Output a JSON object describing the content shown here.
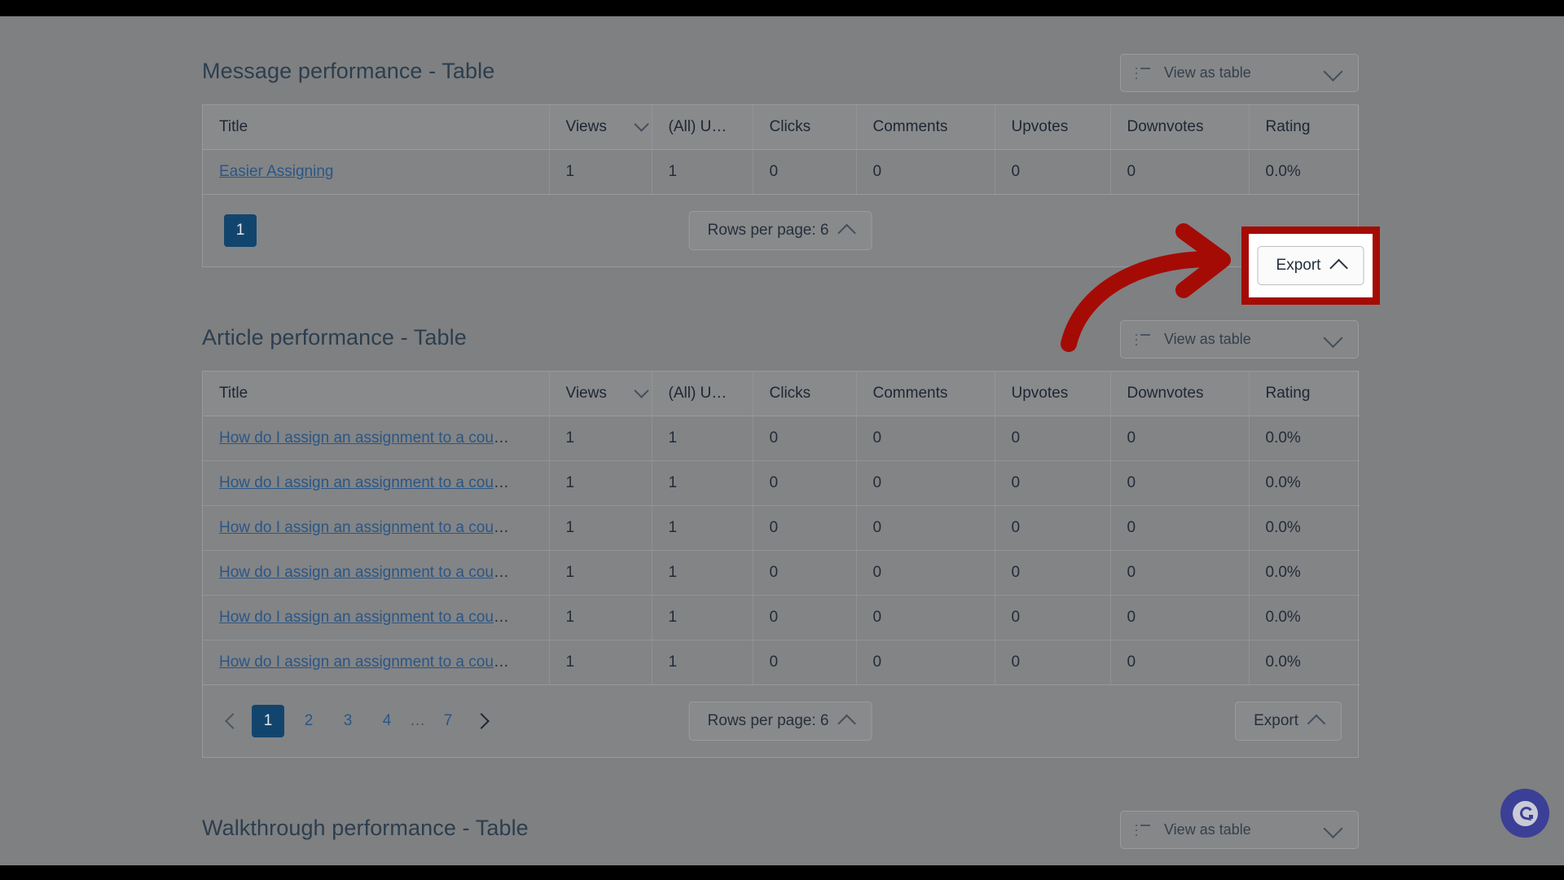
{
  "page": {
    "background_color": "#7f8082",
    "letterbox_color": "#000000"
  },
  "annotation": {
    "highlight_color": "#a50b05",
    "arrow_color": "#a50b05",
    "target": "export-button-message-table"
  },
  "sections": [
    {
      "id": "message-performance",
      "title": "Message performance - Table",
      "view_toggle": {
        "label": "View as table",
        "icon": "list-icon",
        "chevron": "chevron-down-icon"
      },
      "columns": [
        {
          "key": "title",
          "label": "Title",
          "sorted": false
        },
        {
          "key": "views",
          "label": "Views",
          "sorted": true
        },
        {
          "key": "all_u",
          "label": "(All) U…",
          "sorted": false
        },
        {
          "key": "clicks",
          "label": "Clicks",
          "sorted": false
        },
        {
          "key": "comments",
          "label": "Comments",
          "sorted": false
        },
        {
          "key": "upvotes",
          "label": "Upvotes",
          "sorted": false
        },
        {
          "key": "downvotes",
          "label": "Downvotes",
          "sorted": false
        },
        {
          "key": "rating",
          "label": "Rating",
          "sorted": false
        }
      ],
      "rows": [
        {
          "title": "Easier Assigning",
          "views": "1",
          "all_u": "1",
          "clicks": "0",
          "comments": "0",
          "upvotes": "0",
          "downvotes": "0",
          "rating": "0.0%"
        }
      ],
      "footer": {
        "pagination": {
          "show_arrows": false,
          "pages": [
            "1"
          ],
          "active_page": "1",
          "ellipsis": ""
        },
        "rows_per_page_label": "Rows per page: 6",
        "rows_per_page_chevron": "chevron-up-icon",
        "export_label": "Export",
        "export_chevron": "chevron-up-icon",
        "export_highlighted": true
      }
    },
    {
      "id": "article-performance",
      "title": "Article performance - Table",
      "view_toggle": {
        "label": "View as table",
        "icon": "list-icon",
        "chevron": "chevron-down-icon"
      },
      "columns": [
        {
          "key": "title",
          "label": "Title",
          "sorted": false
        },
        {
          "key": "views",
          "label": "Views",
          "sorted": true
        },
        {
          "key": "all_u",
          "label": "(All) U…",
          "sorted": false
        },
        {
          "key": "clicks",
          "label": "Clicks",
          "sorted": false
        },
        {
          "key": "comments",
          "label": "Comments",
          "sorted": false
        },
        {
          "key": "upvotes",
          "label": "Upvotes",
          "sorted": false
        },
        {
          "key": "downvotes",
          "label": "Downvotes",
          "sorted": false
        },
        {
          "key": "rating",
          "label": "Rating",
          "sorted": false
        }
      ],
      "rows": [
        {
          "title": "How do I assign an assignment to a cou",
          "truncation": "…",
          "views": "1",
          "all_u": "1",
          "clicks": "0",
          "comments": "0",
          "upvotes": "0",
          "downvotes": "0",
          "rating": "0.0%"
        },
        {
          "title": "How do I assign an assignment to a cou",
          "truncation": "…",
          "views": "1",
          "all_u": "1",
          "clicks": "0",
          "comments": "0",
          "upvotes": "0",
          "downvotes": "0",
          "rating": "0.0%"
        },
        {
          "title": "How do I assign an assignment to a cou",
          "truncation": "…",
          "views": "1",
          "all_u": "1",
          "clicks": "0",
          "comments": "0",
          "upvotes": "0",
          "downvotes": "0",
          "rating": "0.0%"
        },
        {
          "title": "How do I assign an assignment to a cou",
          "truncation": "…",
          "views": "1",
          "all_u": "1",
          "clicks": "0",
          "comments": "0",
          "upvotes": "0",
          "downvotes": "0",
          "rating": "0.0%"
        },
        {
          "title": "How do I assign an assignment to a cou",
          "truncation": "…",
          "views": "1",
          "all_u": "1",
          "clicks": "0",
          "comments": "0",
          "upvotes": "0",
          "downvotes": "0",
          "rating": "0.0%"
        },
        {
          "title": "How do I assign an assignment to a cou",
          "truncation": "…",
          "views": "1",
          "all_u": "1",
          "clicks": "0",
          "comments": "0",
          "upvotes": "0",
          "downvotes": "0",
          "rating": "0.0%"
        }
      ],
      "footer": {
        "pagination": {
          "show_arrows": true,
          "prev_icon": "chevron-left-icon",
          "next_icon": "chevron-right-icon",
          "pages": [
            "1",
            "2",
            "3",
            "4"
          ],
          "ellipsis": "…",
          "last_page": "7",
          "active_page": "1"
        },
        "rows_per_page_label": "Rows per page: 6",
        "rows_per_page_chevron": "chevron-up-icon",
        "export_label": "Export",
        "export_chevron": "chevron-up-icon",
        "export_highlighted": false
      }
    },
    {
      "id": "walkthrough-performance",
      "title": "Walkthrough performance - Table",
      "view_toggle": {
        "label": "View as table",
        "icon": "list-icon",
        "chevron": "chevron-down-icon"
      },
      "columns": [],
      "rows": [],
      "footer": null
    }
  ],
  "chat_widget": {
    "icon": "chat-bubble-icon",
    "color": "#3b3f96"
  }
}
